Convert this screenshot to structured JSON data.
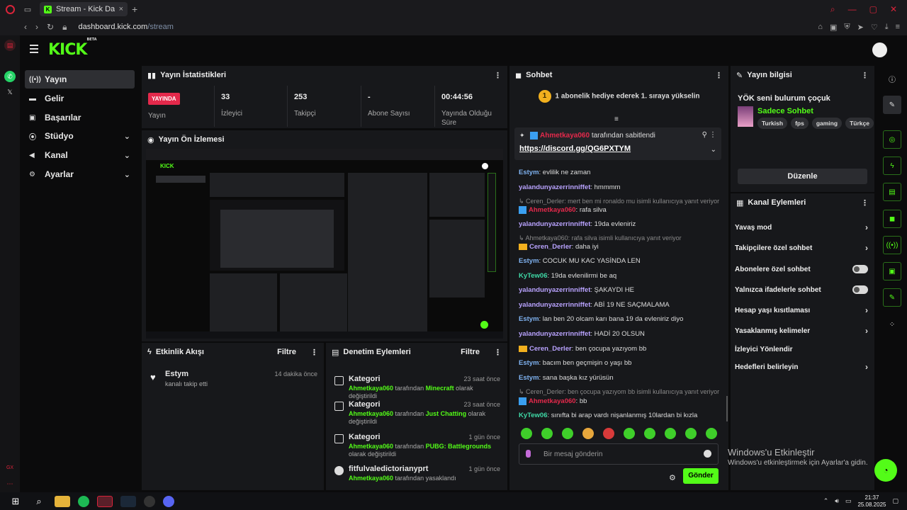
{
  "browser": {
    "tab_title": "Stream - Kick Dashboard",
    "tab_favicon": "K",
    "url_host": "dashboard.kick.com",
    "url_path": "/stream"
  },
  "header": {
    "logo": "KICK",
    "logo_sup": "BETA"
  },
  "nav": [
    {
      "label": "Yayın",
      "icon": "broadcast-icon"
    },
    {
      "label": "Gelir",
      "icon": "revenue-icon"
    },
    {
      "label": "Başarılar",
      "icon": "trophy-icon"
    },
    {
      "label": "Stüdyo",
      "icon": "studio-icon"
    },
    {
      "label": "Kanal",
      "icon": "channel-icon"
    },
    {
      "label": "Ayarlar",
      "icon": "gear-icon"
    }
  ],
  "stats": {
    "title": "Yayın İstatistikleri",
    "live_badge": "YAYINDA",
    "live_label": "Yayın",
    "items": [
      {
        "value": "33",
        "label": "İzleyici"
      },
      {
        "value": "253",
        "label": "Takipçi"
      },
      {
        "value": "-",
        "label": "Abone Sayısı"
      },
      {
        "value": "00:44:56",
        "label": "Yayında Olduğu Süre"
      }
    ]
  },
  "preview": {
    "title": "Yayın Ön İzlemesi"
  },
  "activity": {
    "title": "Etkinlik Akışı",
    "filter": "Filtre",
    "items": [
      {
        "name": "Estym",
        "desc": "kanalı takip etti",
        "time": "14 dakika önce"
      }
    ]
  },
  "moderation": {
    "title": "Denetim Eylemleri",
    "filter": "Filtre",
    "items": [
      {
        "title": "Kategori",
        "time": "23 saat önce",
        "user": "Ahmetkaya060",
        "mid": " tarafından ",
        "obj": "Minecraft",
        "end": " olarak değiştirildi"
      },
      {
        "title": "Kategori",
        "time": "23 saat önce",
        "user": "Ahmetkaya060",
        "mid": " tarafından ",
        "obj": "Just Chatting",
        "end": " olarak değiştirildi"
      },
      {
        "title": "Kategori",
        "time": "1 gün önce",
        "user": "Ahmetkaya060",
        "mid": " tarafından ",
        "obj": "PUBG: Battlegrounds",
        "end": " olarak değiştirildi"
      },
      {
        "title": "fitfulvaledictorianyprt",
        "time": "1 gün önce",
        "user": "Ahmetkaya060",
        "mid": " tarafından yasaklandı",
        "obj": "",
        "end": ""
      }
    ]
  },
  "chat": {
    "title": "Sohbet",
    "gift_rank": "1",
    "gift_text": "1 abonelik hediye ederek 1. sıraya yükselin",
    "pinned": {
      "user": "Ahmetkaya060",
      "by_text": " tarafından sabitlendi",
      "link": "https://discord.gg/QG6PXTYM"
    },
    "messages": [
      {
        "type": "msg",
        "user": "Estym",
        "color": "#7fb2f0",
        "badge": "",
        "text": ": evlilik ne zaman"
      },
      {
        "type": "msg",
        "user": "yalandunyazerrinniffet",
        "color": "#b9a3ff",
        "badge": "",
        "text": ": hmmmm"
      },
      {
        "type": "reply",
        "text": "↳ Ceren_Derler: mert ben mi ronaldo mu isimli kullanıcıya yanıt veriyor"
      },
      {
        "type": "msg",
        "user": "Ahmetkaya060",
        "color": "#e4294b",
        "badge": "mod",
        "text": ": rafa silva"
      },
      {
        "type": "msg",
        "user": "yalandunyazerrinniffet",
        "color": "#b9a3ff",
        "badge": "",
        "text": ": 19da evleniriz"
      },
      {
        "type": "reply",
        "text": "↳ Ahmetkaya060: rafa silva isimli kullanıcıya yanıt veriyor"
      },
      {
        "type": "msg",
        "user": "Ceren_Derler",
        "color": "#b9a3ff",
        "badge": "crown",
        "text": ": daha iyi"
      },
      {
        "type": "msg",
        "user": "Estym",
        "color": "#7fb2f0",
        "badge": "",
        "text": ": COCUK MU KAC YASİNDA LEN"
      },
      {
        "type": "msg",
        "user": "KyTew06",
        "color": "#3fd9a6",
        "badge": "",
        "text": ": 19da evlenilirmi be aq"
      },
      {
        "type": "msg",
        "user": "yalandunyazerrinniffet",
        "color": "#b9a3ff",
        "badge": "",
        "text": ": ŞAKAYDI HE"
      },
      {
        "type": "msg",
        "user": "yalandunyazerrinniffet",
        "color": "#b9a3ff",
        "badge": "",
        "text": ": ABİ 19 NE SAÇMALAMA"
      },
      {
        "type": "msg",
        "user": "Estym",
        "color": "#7fb2f0",
        "badge": "",
        "text": ": lan ben 20 olcam karı bana 19 da evleniriz diyo"
      },
      {
        "type": "msg",
        "user": "yalandunyazerrinniffet",
        "color": "#b9a3ff",
        "badge": "",
        "text": ": HADİ 20 OLSUN"
      },
      {
        "type": "msg",
        "user": "Ceren_Derler",
        "color": "#b9a3ff",
        "badge": "crown",
        "text": ": ben çocupa yazıyom bb"
      },
      {
        "type": "msg",
        "user": "Estym",
        "color": "#7fb2f0",
        "badge": "",
        "text": ": bacım ben geçmişin o yaşı bb"
      },
      {
        "type": "msg",
        "user": "Estym",
        "color": "#7fb2f0",
        "badge": "",
        "text": ": sana başka kız yürüsün"
      },
      {
        "type": "reply",
        "text": "↳ Ceren_Derler: ben çocupa yazıyom bb isimli kullanıcıya yanıt veriyor"
      },
      {
        "type": "msg",
        "user": "Ahmetkaya060",
        "color": "#e4294b",
        "badge": "mod",
        "text": ": bb"
      },
      {
        "type": "msg",
        "user": "KyTew06",
        "color": "#3fd9a6",
        "badge": "",
        "text": ": sınıfta bi arap vardı nişanlanmış 10lardan bi kızla"
      }
    ],
    "input_placeholder": "Bir mesaj gönderin",
    "send": "Gönder"
  },
  "info": {
    "title": "Yayın bilgisi",
    "stream_title": "YÖK seni bulurum çoçuk",
    "category": "Sadece Sohbet",
    "tags": [
      "Turkish",
      "fps",
      "gaming",
      "Türkçe"
    ],
    "edit": "Düzenle"
  },
  "actions": {
    "title": "Kanal Eylemleri",
    "items": [
      {
        "label": "Yavaş mod",
        "kind": "arrow"
      },
      {
        "label": "Takipçilere özel sohbet",
        "kind": "arrow"
      },
      {
        "label": "Abonelere özel sohbet",
        "kind": "toggle"
      },
      {
        "label": "Yalnızca ifadelerle sohbet",
        "kind": "toggle"
      },
      {
        "label": "Hesap yaşı kısıtlaması",
        "kind": "arrow"
      },
      {
        "label": "Yasaklanmış kelimeler",
        "kind": "arrow"
      },
      {
        "label": "İzleyici Yönlendir",
        "kind": "none"
      },
      {
        "label": "Hedefleri belirleyin",
        "kind": "arrow"
      }
    ]
  },
  "watermark": {
    "line1": "Windows'u Etkinleştir",
    "line2": "Windows'u etkinleştirmek için Ayarlar'a gidin."
  },
  "taskbar": {
    "time": "21:37",
    "date": "25.08.2025"
  },
  "colors": {
    "accent": "#53fc18",
    "live": "#e4294b",
    "panel": "#17181b"
  }
}
